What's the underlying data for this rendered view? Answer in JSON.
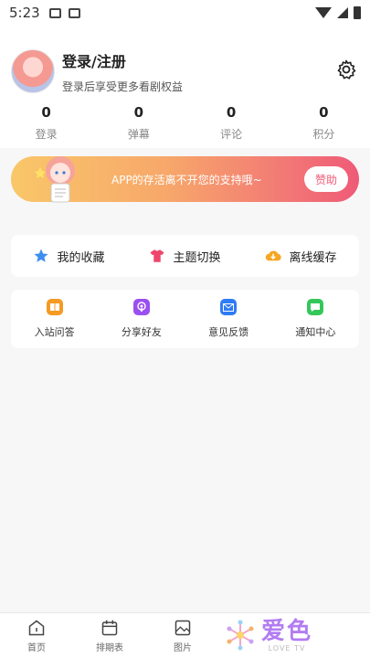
{
  "status_bar": {
    "time": "5:23"
  },
  "profile": {
    "title": "登录/注册",
    "subtitle": "登录后享受更多看剧权益"
  },
  "stats": [
    {
      "value": "0",
      "label": "登录"
    },
    {
      "value": "0",
      "label": "弹幕"
    },
    {
      "value": "0",
      "label": "评论"
    },
    {
      "value": "0",
      "label": "积分"
    }
  ],
  "banner": {
    "text": "APP的存活离不开您的支持哦~",
    "button_label": "赞助"
  },
  "quick_actions": [
    {
      "label": "我的收藏",
      "icon": "star-icon",
      "color": "#3d8ef0"
    },
    {
      "label": "主题切换",
      "icon": "shirt-icon",
      "color": "#f0456b"
    },
    {
      "label": "离线缓存",
      "icon": "download-icon",
      "color": "#f5a623"
    }
  ],
  "services": [
    {
      "label": "入站问答",
      "icon": "book-icon",
      "color": "#f59a23"
    },
    {
      "label": "分享好友",
      "icon": "podcast-icon",
      "color": "#9b4ff0"
    },
    {
      "label": "意见反馈",
      "icon": "mail-icon",
      "color": "#2f7cf6"
    },
    {
      "label": "通知中心",
      "icon": "chat-icon",
      "color": "#34c759"
    }
  ],
  "bottom_nav": [
    {
      "label": "首页",
      "icon": "home-icon"
    },
    {
      "label": "排期表",
      "icon": "calendar-icon"
    },
    {
      "label": "图片",
      "icon": "image-icon"
    }
  ],
  "watermark": {
    "main": "爱色",
    "sub": "LOVE TV"
  }
}
